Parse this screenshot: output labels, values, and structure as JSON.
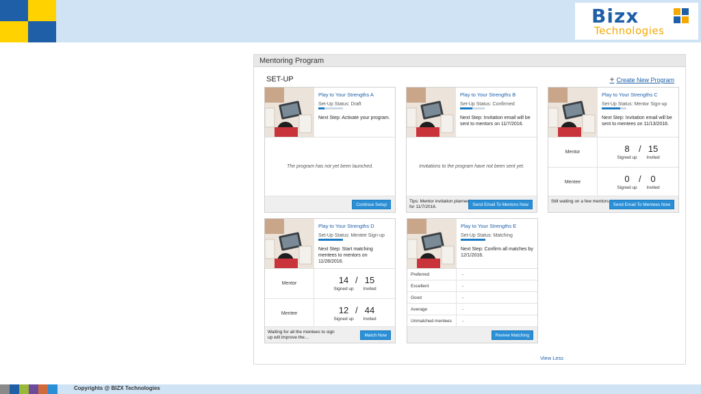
{
  "brand": {
    "name": "Bizx",
    "tagline": "Technologies",
    "blue": "#1f5fa8",
    "yellow": "#ffd200",
    "orange": "#f5a800"
  },
  "panel": {
    "title": "Mentoring Program",
    "section_label": "SET-UP",
    "create_link": "Create New Program",
    "view_less": "View Less"
  },
  "cards": [
    {
      "name": "Play to Your Strengths A",
      "status": "Set-Up Status: Draft",
      "progress": 0.25,
      "next": "Next Step: Activate your program.",
      "message": "The program has not yet been launched.",
      "button": "Continue Setup"
    },
    {
      "name": "Play to Your Strengths B",
      "status": "Set-Up Status: Confirmed",
      "progress": 0.5,
      "next": "Next Step: Invitation email will be sent to mentors on 11/7/2016.",
      "message": "Invitations to the program have not been sent yet.",
      "tip": "Tips: Mentor invitation planned for 11/7/2016.",
      "button": "Send Email To Mentors Now"
    },
    {
      "name": "Play to Your Strengths C",
      "status": "Set-Up Status: Mentor Sign-up",
      "progress": 0.75,
      "next": "Next Step: Invitation email will be sent to mentees on 11/13/2016.",
      "rows": [
        {
          "label": "Mentor",
          "signed": "8",
          "invited": "15"
        },
        {
          "label": "Mentee",
          "signed": "0",
          "invited": "0"
        }
      ],
      "signed_label": "Signed up",
      "invited_label": "Invited",
      "tip": "Still waiting on a few mentors.",
      "button": "Send Email To Mentees Now"
    },
    {
      "name": "Play to Your Strengths D",
      "status": "Set-Up Status: Mentee Sign-up",
      "progress": 1.0,
      "next": "Next Step: Start matching mentees to mentors on 11/28/2016.",
      "rows": [
        {
          "label": "Mentor",
          "signed": "14",
          "invited": "15"
        },
        {
          "label": "Mentee",
          "signed": "12",
          "invited": "44"
        }
      ],
      "signed_label": "Signed up",
      "invited_label": "Invited",
      "tip": "Waiting for all the mentees to sign up will improve the…",
      "button": "Match Now"
    },
    {
      "name": "Play to Your Strengths E",
      "status": "Set-Up Status: Matching",
      "progress": 1.0,
      "next": "Next Step: Confirm all matches by 12/1/2016.",
      "match_rows": [
        {
          "label": "Preferred",
          "value": "-"
        },
        {
          "label": "Excellent",
          "value": "-"
        },
        {
          "label": "Good",
          "value": "-"
        },
        {
          "label": "Average",
          "value": "-"
        },
        {
          "label": "Unmatched mentees",
          "value": "-"
        }
      ],
      "button": "Review Matching"
    }
  ],
  "footer": {
    "copyright": "Copyrights @ BIZX Technologies"
  }
}
